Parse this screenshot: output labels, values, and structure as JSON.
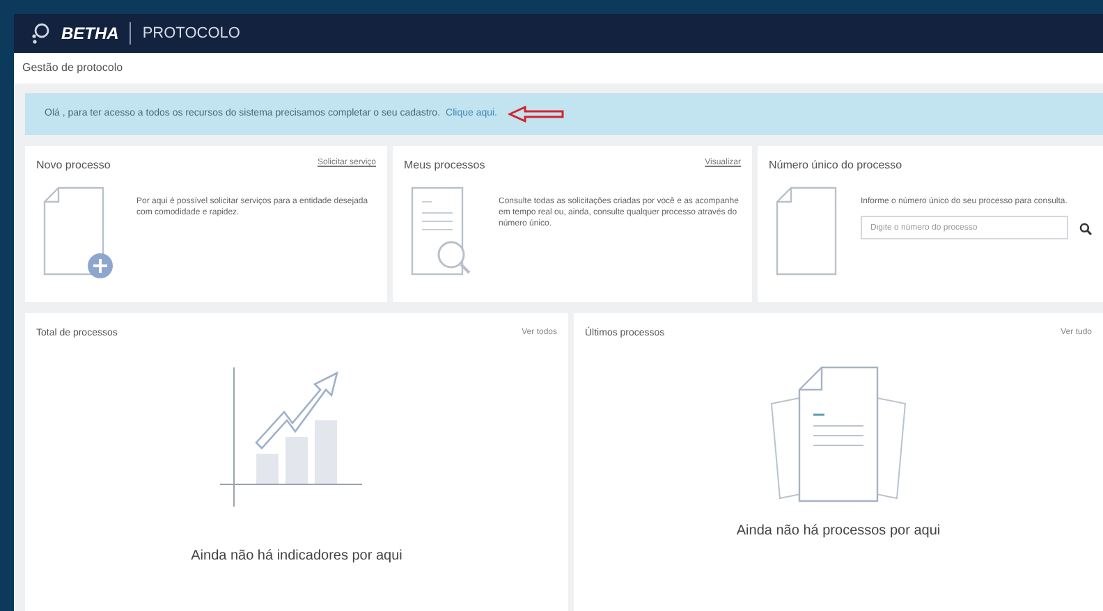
{
  "header": {
    "brand": "BETHA",
    "product": "PROTOCOLO"
  },
  "breadcrumb": "Gestão de protocolo",
  "alert": {
    "text": "Olá , para ter acesso a todos os recursos do sistema precisamos completar o seu cadastro.",
    "link": "Clique aqui."
  },
  "cards": [
    {
      "kind": "new",
      "title": "Novo processo",
      "link": "Solicitar serviço",
      "text": "Por aqui é possível solicitar serviços para a entidade desejada com comodidade e rapidez."
    },
    {
      "kind": "mine",
      "title": "Meus processos",
      "link": "Visualizar",
      "text": "Consulte todas as solicitações criadas por você e as acompanhe em tempo real ou, ainda, consulte qualquer processo através do número único."
    },
    {
      "kind": "search",
      "title": "Número único do processo",
      "text": "Informe o número único do seu processo para consulta.",
      "placeholder": "Digite o número do processo"
    }
  ],
  "panels": [
    {
      "kind": "chart",
      "title": "Total de processos",
      "link": "Ver todos",
      "empty": "Ainda não há indicadores por aqui"
    },
    {
      "kind": "docs",
      "title": "Últimos processos",
      "link": "Ver tudo",
      "empty": "Ainda não há processos por aqui"
    }
  ]
}
